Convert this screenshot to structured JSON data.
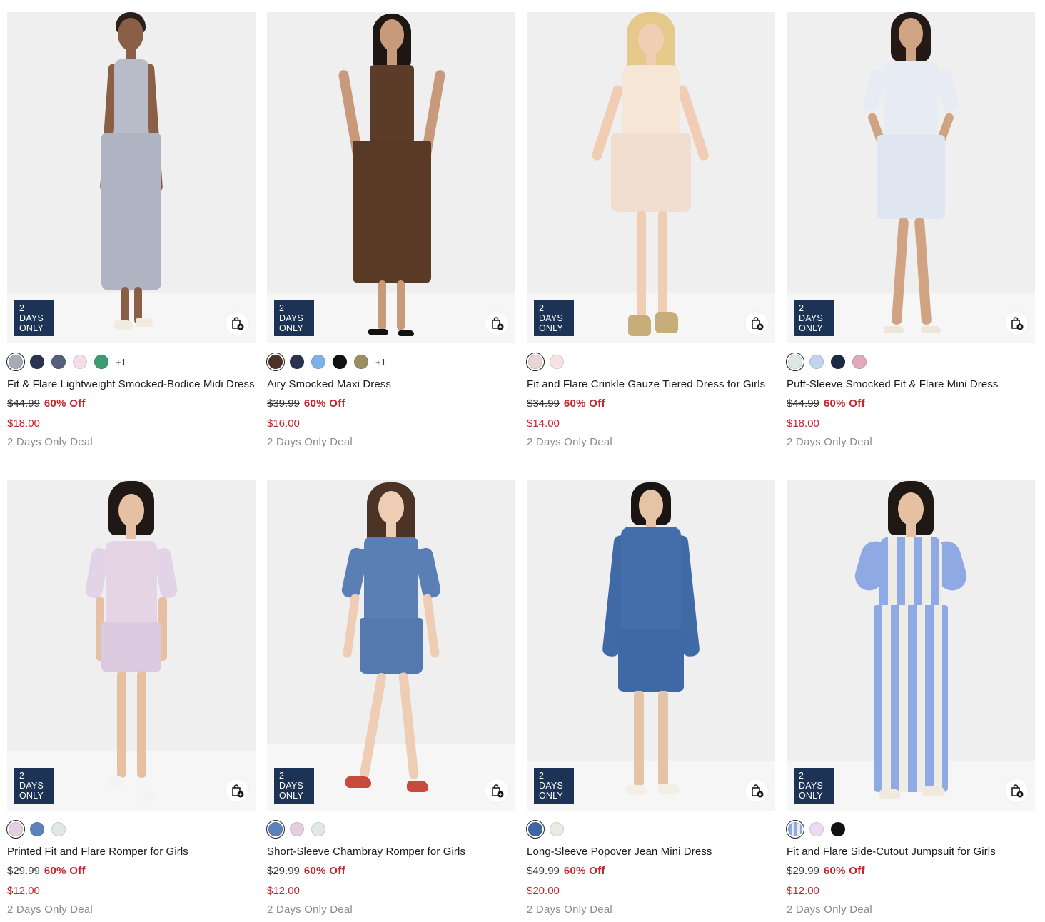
{
  "badge_text": "2 DAYS ONLY",
  "bag_icon": "bag-plus-icon",
  "products": [
    {
      "name": "Fit & Flare Lightweight Smocked-Bodice Midi Dress",
      "original_price": "$44.99",
      "discount": "60% Off",
      "sale_price": "$18.00",
      "deal": "2 Days Only Deal",
      "swatches": [
        "#a7abb6",
        "#2b3350",
        "#55607e",
        "#f4dde8",
        "#3d9c74"
      ],
      "selected_swatch": 0,
      "more_colors": "+1"
    },
    {
      "name": "Airy Smocked Maxi Dress",
      "original_price": "$39.99",
      "discount": "60% Off",
      "sale_price": "$16.00",
      "deal": "2 Days Only Deal",
      "swatches": [
        "#4a3326",
        "#2b3350",
        "#7fb1e8",
        "#111111",
        "#9a8f62"
      ],
      "selected_swatch": 0,
      "more_colors": "+1"
    },
    {
      "name": "Fit and Flare Crinkle Gauze Tiered Dress for Girls",
      "original_price": "$34.99",
      "discount": "60% Off",
      "sale_price": "$14.00",
      "deal": "2 Days Only Deal",
      "swatches": [
        "#e9d6d2",
        "#f6e4e4"
      ],
      "selected_swatch": 0,
      "more_colors": ""
    },
    {
      "name": "Puff-Sleeve Smocked Fit & Flare Mini Dress",
      "original_price": "$44.99",
      "discount": "60% Off",
      "sale_price": "$18.00",
      "deal": "2 Days Only Deal",
      "swatches": [
        "#dfe6e6",
        "#c2d3ec",
        "#1e2a44",
        "#e2a9bc"
      ],
      "selected_swatch": 0,
      "more_colors": ""
    },
    {
      "name": "Printed Fit and Flare Romper for Girls",
      "original_price": "$29.99",
      "discount": "60% Off",
      "sale_price": "$12.00",
      "deal": "2 Days Only Deal",
      "swatches": [
        "#e3cfe0",
        "#5b82ba",
        "#dfe8e2"
      ],
      "selected_swatch": 0,
      "more_colors": ""
    },
    {
      "name": "Short-Sleeve Chambray Romper for Girls",
      "original_price": "$29.99",
      "discount": "60% Off",
      "sale_price": "$12.00",
      "deal": "2 Days Only Deal",
      "swatches": [
        "#5b82ba",
        "#e3cfe0",
        "#dfe8e2"
      ],
      "selected_swatch": 0,
      "more_colors": ""
    },
    {
      "name": "Long-Sleeve Popover Jean Mini Dress",
      "original_price": "$49.99",
      "discount": "60% Off",
      "sale_price": "$20.00",
      "deal": "2 Days Only Deal",
      "swatches": [
        "#3f67a4",
        "#ece9e2"
      ],
      "selected_swatch": 0,
      "more_colors": ""
    },
    {
      "name": "Fit and Flare Side-Cutout Jumpsuit for Girls",
      "original_price": "$29.99",
      "discount": "60% Off",
      "sale_price": "$12.00",
      "deal": "2 Days Only Deal",
      "swatches": [
        "#b8c9ec",
        "#ecdaf0",
        "#111111"
      ],
      "selected_swatch": 0,
      "more_colors": ""
    }
  ]
}
